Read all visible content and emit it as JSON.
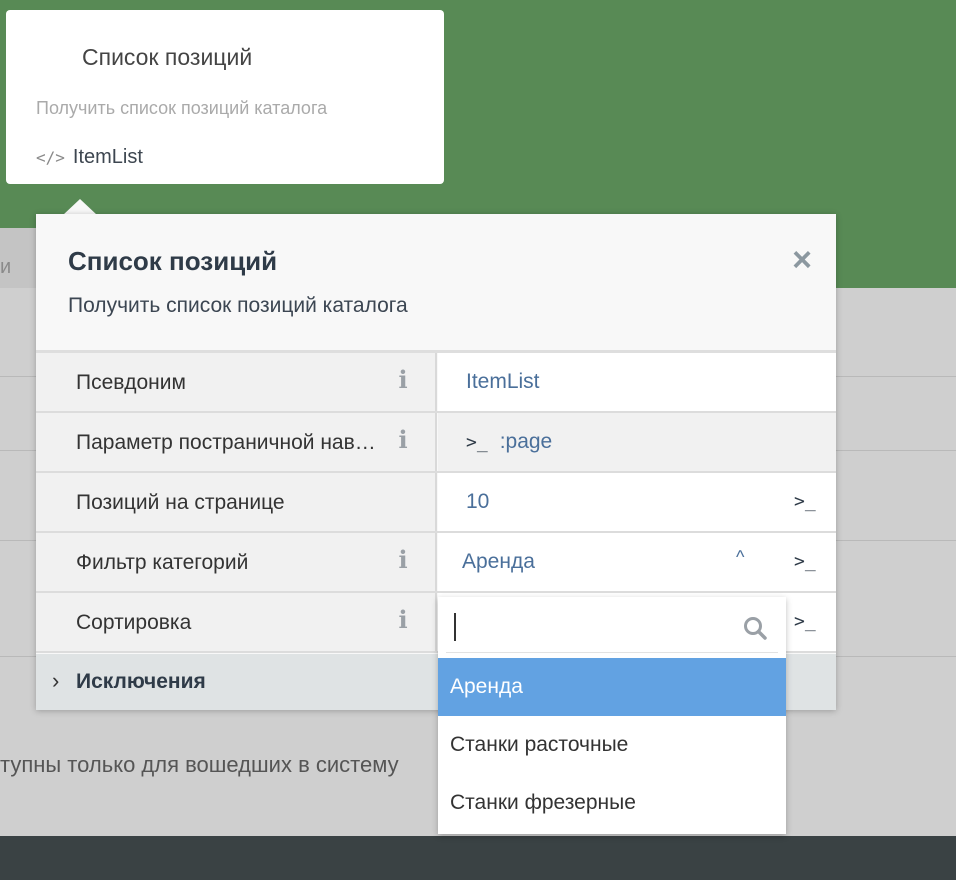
{
  "background": {
    "left_label": "и",
    "footer_text": "тупны только для вошедших в систему"
  },
  "card": {
    "title": "Список позиций",
    "subtitle": "Получить список позиций каталога",
    "code_icon": "</>",
    "code_name": "ItemList"
  },
  "popup": {
    "title": "Список позиций",
    "subtitle": "Получить список позиций каталога",
    "close_icon": "×",
    "rows": [
      {
        "label": "Псевдоним",
        "value": "ItemList"
      },
      {
        "label": "Параметр постраничной навигации",
        "value_prefix": ">_",
        "value": ":page"
      },
      {
        "label": "Позиций на странице",
        "value": "10",
        "action": ">_"
      },
      {
        "label": "Фильтр категорий",
        "value": "Аренда",
        "chevron": "^",
        "action": ">_"
      },
      {
        "label": "Сортировка",
        "action": ">_"
      }
    ],
    "exclusions": {
      "chevron": "›",
      "label": "Исключения"
    }
  },
  "dropdown": {
    "search_placeholder": "",
    "options": [
      {
        "label": "Аренда",
        "selected": true
      },
      {
        "label": "Станки расточные",
        "selected": false
      },
      {
        "label": "Станки фрезерные",
        "selected": false
      }
    ]
  }
}
